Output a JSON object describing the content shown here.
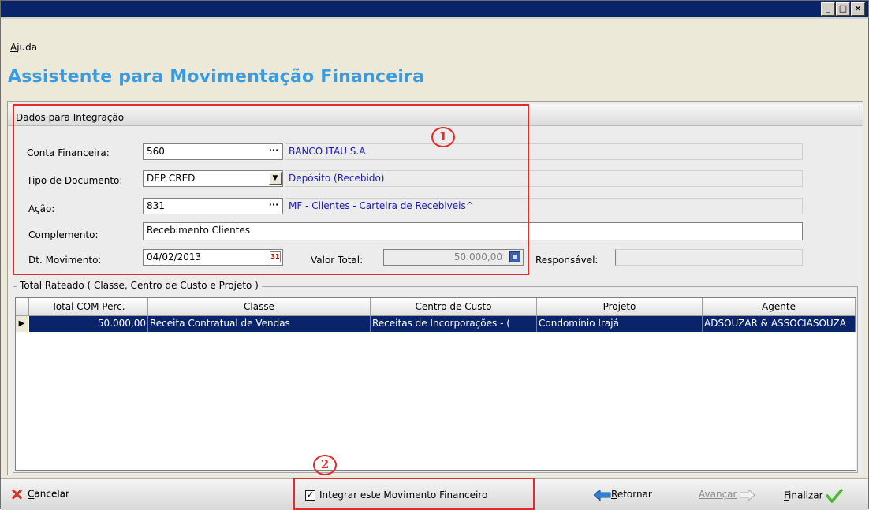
{
  "window": {
    "minimize_glyph": "_",
    "maximize_glyph": "□",
    "close_glyph": "×"
  },
  "menu": {
    "help_accel": "A",
    "help_rest": "juda"
  },
  "page_title": "Assistente para Movimentação Financeira",
  "section": {
    "title": "Dados para Integração"
  },
  "form": {
    "conta_label": "Conta Financeira:",
    "conta_value": "560",
    "conta_desc": "BANCO ITAU S.A.",
    "tipo_label": "Tipo de Documento:",
    "tipo_value": "DEP CRED",
    "tipo_desc": "Depósito (Recebido)",
    "acao_label": "Ação:",
    "acao_value": "831",
    "acao_desc": "MF - Clientes - Carteira de Recebiveis^",
    "complemento_label": "Complemento:",
    "complemento_value": "Recebimento Clientes",
    "dt_label": "Dt. Movimento:",
    "dt_value": "04/02/2013",
    "valor_label": "Valor Total:",
    "valor_value": "50.000,00",
    "responsavel_label": "Responsável:",
    "responsavel_value": ""
  },
  "annotations": {
    "one": "1",
    "two": "2"
  },
  "group": {
    "title": "Total Rateado ( Classe, Centro de Custo e Projeto )"
  },
  "grid": {
    "columns": [
      "Total COM Perc.",
      "Classe",
      "Centro de Custo",
      "Projeto",
      "Agente"
    ],
    "rows": [
      [
        "50.000,00",
        "Receita Contratual de Vendas",
        "Receitas de Incorporações - (",
        "Condomínio Irajá",
        "ADSOUZAR & ASSOCIASOUZA"
      ]
    ]
  },
  "footer": {
    "cancel_accel": "C",
    "cancel_rest": "ancelar",
    "integrate_label": "Integrar este Movimento Financeiro",
    "integrate_checked": true,
    "back_accel": "R",
    "back_rest": "etornar",
    "next_label": "Avançar",
    "finish_accel": "F",
    "finish_rest": "inalizar"
  },
  "colors": {
    "title_blue": "#3a9be0",
    "highlight_red": "#e32b2b",
    "selection_navy": "#0a246a"
  }
}
